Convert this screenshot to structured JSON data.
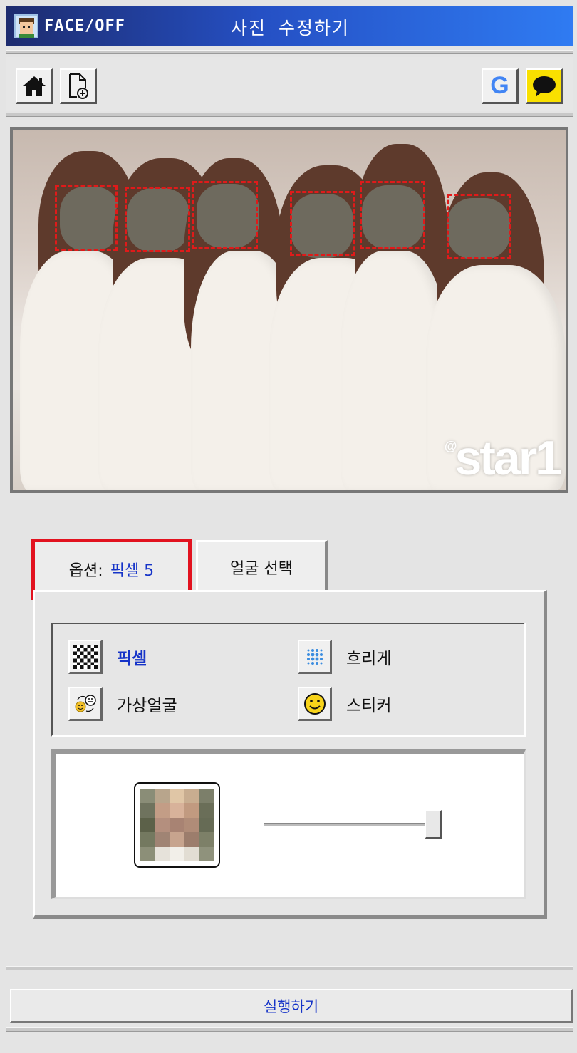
{
  "titlebar": {
    "app_name": "FACE/OFF",
    "title": "사진 수정하기"
  },
  "toolbar": {
    "left_icons": [
      "home-icon",
      "new-file-icon"
    ],
    "right_icons": [
      "google-icon",
      "kakao-chat-icon"
    ],
    "google_letter": "G"
  },
  "photo": {
    "watermark_at": "@",
    "watermark_text": "star1",
    "detected_faces_count": 6,
    "face_box_color": "#e01a1a"
  },
  "tabs": {
    "options_prefix": "옵션:",
    "options_value": "픽셀 5",
    "face_select": "얼굴 선택"
  },
  "effects": {
    "pixel": "픽셀",
    "blur": "흐리게",
    "virtual_face": "가상얼굴",
    "sticker": "스티커",
    "selected": "pixel"
  },
  "slider": {
    "value_fraction": 0.95
  },
  "run_button": "실행하기",
  "colors": {
    "accent_blue": "#1533c8",
    "highlight_red": "#e2121f",
    "title_gradient_start": "#1d2b6e",
    "title_gradient_end": "#2f7bf2"
  }
}
